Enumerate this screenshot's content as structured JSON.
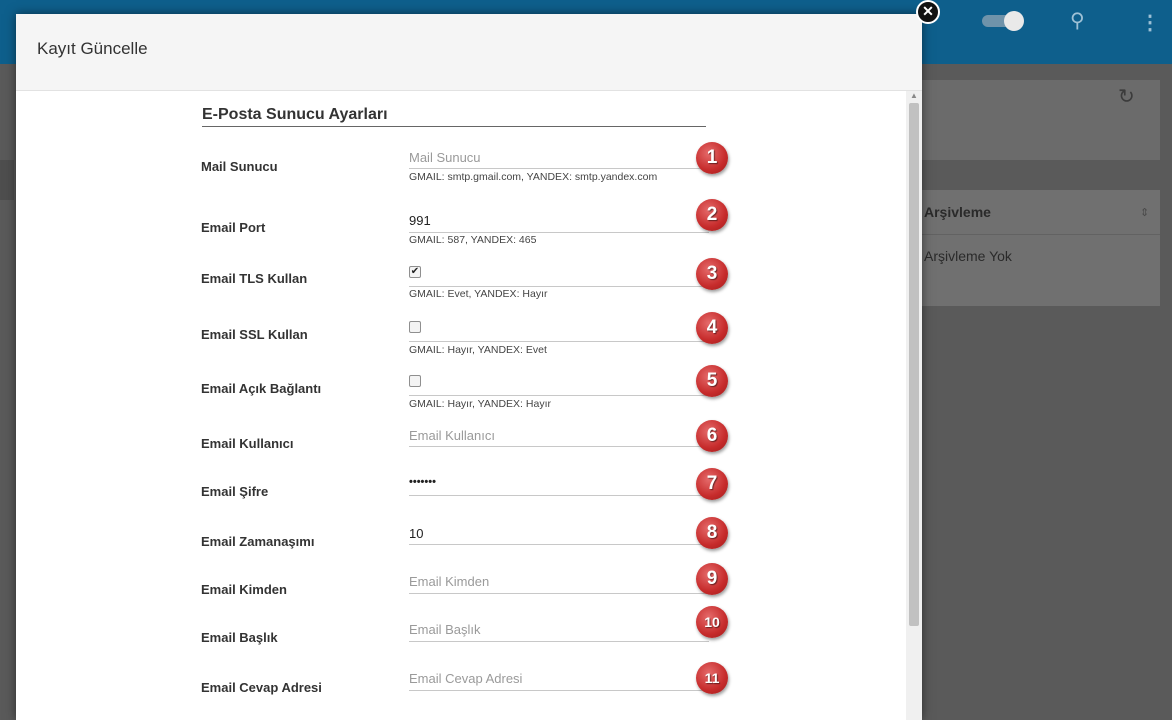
{
  "background": {
    "table_header": "Arşivleme",
    "table_cell": "Arşivleme Yok"
  },
  "modal": {
    "title": "Kayıt Güncelle",
    "section_title": "E-Posta Sunucu Ayarları",
    "fields": [
      {
        "label": "Mail Sunucu",
        "value": "",
        "placeholder": "Mail Sunucu",
        "hint": "GMAIL: smtp.gmail.com, YANDEX: smtp.yandex.com",
        "badge": "1"
      },
      {
        "label": "Email Port",
        "value": "991",
        "placeholder": "",
        "hint": "GMAIL: 587, YANDEX: 465",
        "badge": "2"
      },
      {
        "label": "Email TLS Kullan",
        "checked": true,
        "hint": "GMAIL: Evet, YANDEX: Hayır",
        "badge": "3"
      },
      {
        "label": "Email SSL Kullan",
        "checked": false,
        "hint": "GMAIL: Hayır, YANDEX: Evet",
        "badge": "4"
      },
      {
        "label": "Email Açık Bağlantı",
        "checked": false,
        "hint": "GMAIL: Hayır, YANDEX: Hayır",
        "badge": "5"
      },
      {
        "label": "Email Kullanıcı",
        "value": "",
        "placeholder": "Email Kullanıcı",
        "badge": "6"
      },
      {
        "label": "Email Şifre",
        "value": "•••••••",
        "placeholder": "",
        "badge": "7"
      },
      {
        "label": "Email Zamanaşımı",
        "value": "10",
        "placeholder": "",
        "badge": "8"
      },
      {
        "label": "Email Kimden",
        "value": "",
        "placeholder": "Email Kimden",
        "badge": "9"
      },
      {
        "label": "Email Başlık",
        "value": "",
        "placeholder": "Email Başlık",
        "badge": "10"
      },
      {
        "label": "Email Cevap Adresi",
        "value": "",
        "placeholder": "Email Cevap Adresi",
        "badge": "11"
      }
    ]
  },
  "icons": {
    "close": "close-icon",
    "search": "search-icon",
    "more": "more-vert-icon",
    "refresh": "refresh-icon",
    "toggle": "toggle-switch",
    "badge_color": "#c62b2b"
  }
}
